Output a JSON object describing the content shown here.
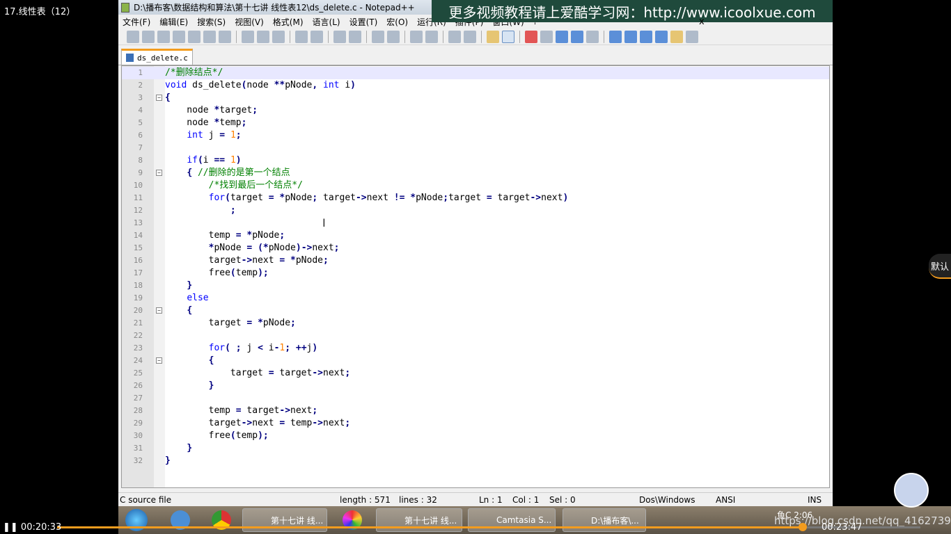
{
  "video": {
    "title": "17.线性表（12）",
    "elapsed": "00:20:33",
    "total": "00:23:47",
    "progress_percent": 86.4,
    "quality_button": "默认"
  },
  "window": {
    "title": "D:\\播布客\\数据结构和算法\\第十七讲 线性表12\\ds_delete.c - Notepad++",
    "ad_banner": "更多视频教程请上爱酷学习网：http://www.icoolxue.com",
    "close": "x"
  },
  "menu": [
    "文件(F)",
    "编辑(E)",
    "搜索(S)",
    "视图(V)",
    "格式(M)",
    "语言(L)",
    "设置(T)",
    "宏(O)",
    "运行(R)",
    "插件(P)",
    "窗口(W)",
    "?"
  ],
  "tab": {
    "label": "ds_delete.c"
  },
  "code": [
    "/*删除结点*/",
    "void ds_delete(node **pNode, int i)",
    "{",
    "    node *target;",
    "    node *temp;",
    "    int j = 1;",
    "",
    "    if(i == 1)",
    "    { //删除的是第一个结点",
    "        /*找到最后一个结点*/",
    "        for(target = *pNode; target->next != *pNode;target = target->next)",
    "            ;",
    "",
    "        temp = *pNode;",
    "        *pNode = (*pNode)->next;",
    "        target->next = *pNode;",
    "        free(temp);",
    "    }",
    "    else",
    "    {",
    "        target = *pNode;",
    "",
    "        for( ; j < i-1; ++j)",
    "        {",
    "            target = target->next;",
    "        }",
    "",
    "        temp = target->next;",
    "        target->next = temp->next;",
    "        free(temp);",
    "    }",
    "}"
  ],
  "fold_lines": [
    3,
    9,
    20,
    24
  ],
  "status": {
    "type": "C source file",
    "length": "length : 571",
    "lines": "lines : 32",
    "ln": "Ln : 1",
    "col": "Col : 1",
    "sel": "Sel : 0",
    "eol": "Dos\\Windows",
    "encoding": "ANSI",
    "mode": "INS"
  },
  "taskbar": {
    "items": [
      "第十七讲 线...",
      "第十七讲 线...",
      "Camtasia S...",
      "D:\\播布客\\..."
    ],
    "clock": "鱼C 2:06",
    "watermark": "https://blog.csdn.net/qq_41627390"
  },
  "colors": {
    "accent": "#f39c1e",
    "keyword": "#0000ff",
    "comment": "#008000",
    "number": "#ff8000"
  }
}
